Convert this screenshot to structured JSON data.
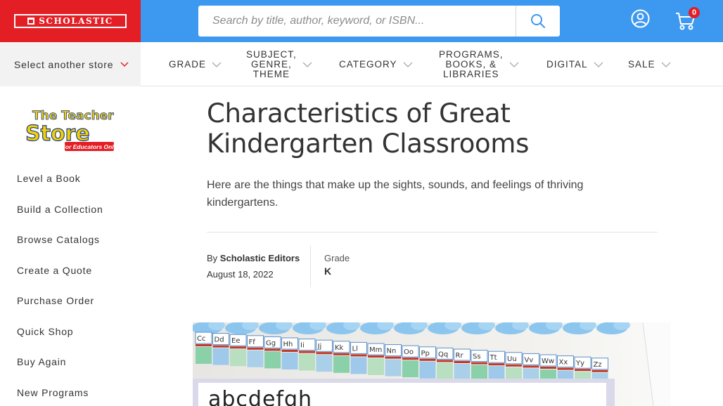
{
  "brand": {
    "name": "SCHOLASTIC",
    "color": "#e31e24"
  },
  "header": {
    "search_placeholder": "Search by title, author, keyword, or ISBN...",
    "cart_count": "0",
    "bar_color": "#3d98f0"
  },
  "nav": {
    "store_select": "Select another store",
    "items": [
      {
        "label": "GRADE"
      },
      {
        "label": "SUBJECT,\nGENRE,\nTHEME"
      },
      {
        "label": "CATEGORY"
      },
      {
        "label": "PROGRAMS,\nBOOKS, &\nLIBRARIES"
      },
      {
        "label": "DIGITAL"
      },
      {
        "label": "SALE"
      }
    ]
  },
  "sidebar": {
    "logo": {
      "line1": "The Teacher",
      "line2": "Store",
      "tagline": "For Educators Only"
    },
    "links": [
      {
        "label": "Level a Book"
      },
      {
        "label": "Build a Collection"
      },
      {
        "label": "Browse Catalogs"
      },
      {
        "label": "Create a Quote"
      },
      {
        "label": "Purchase Order"
      },
      {
        "label": "Quick Shop"
      },
      {
        "label": "Buy Again"
      },
      {
        "label": "New Programs"
      }
    ]
  },
  "article": {
    "title": "Characteristics of Great Kindergarten Classrooms",
    "dek": "Here are the things that make up the sights, sounds, and feelings of thriving kindergartens.",
    "by_prefix": "By",
    "author": "Scholastic Editors",
    "date": "August 18, 2022",
    "grade_label": "Grade",
    "grade_value": "K"
  },
  "hero": {
    "letters": [
      "Cc",
      "Dd",
      "Ee",
      "Ff",
      "Gg",
      "Hh",
      "Ii",
      "Jj",
      "Kk",
      "Ll",
      "Mm",
      "Nn",
      "Oo",
      "Pp",
      "Qq",
      "Rr",
      "Ss",
      "Tt",
      "Uu",
      "Vv",
      "Ww",
      "Xx",
      "Yy",
      "Zz"
    ],
    "board_text": "abcdefgh"
  }
}
